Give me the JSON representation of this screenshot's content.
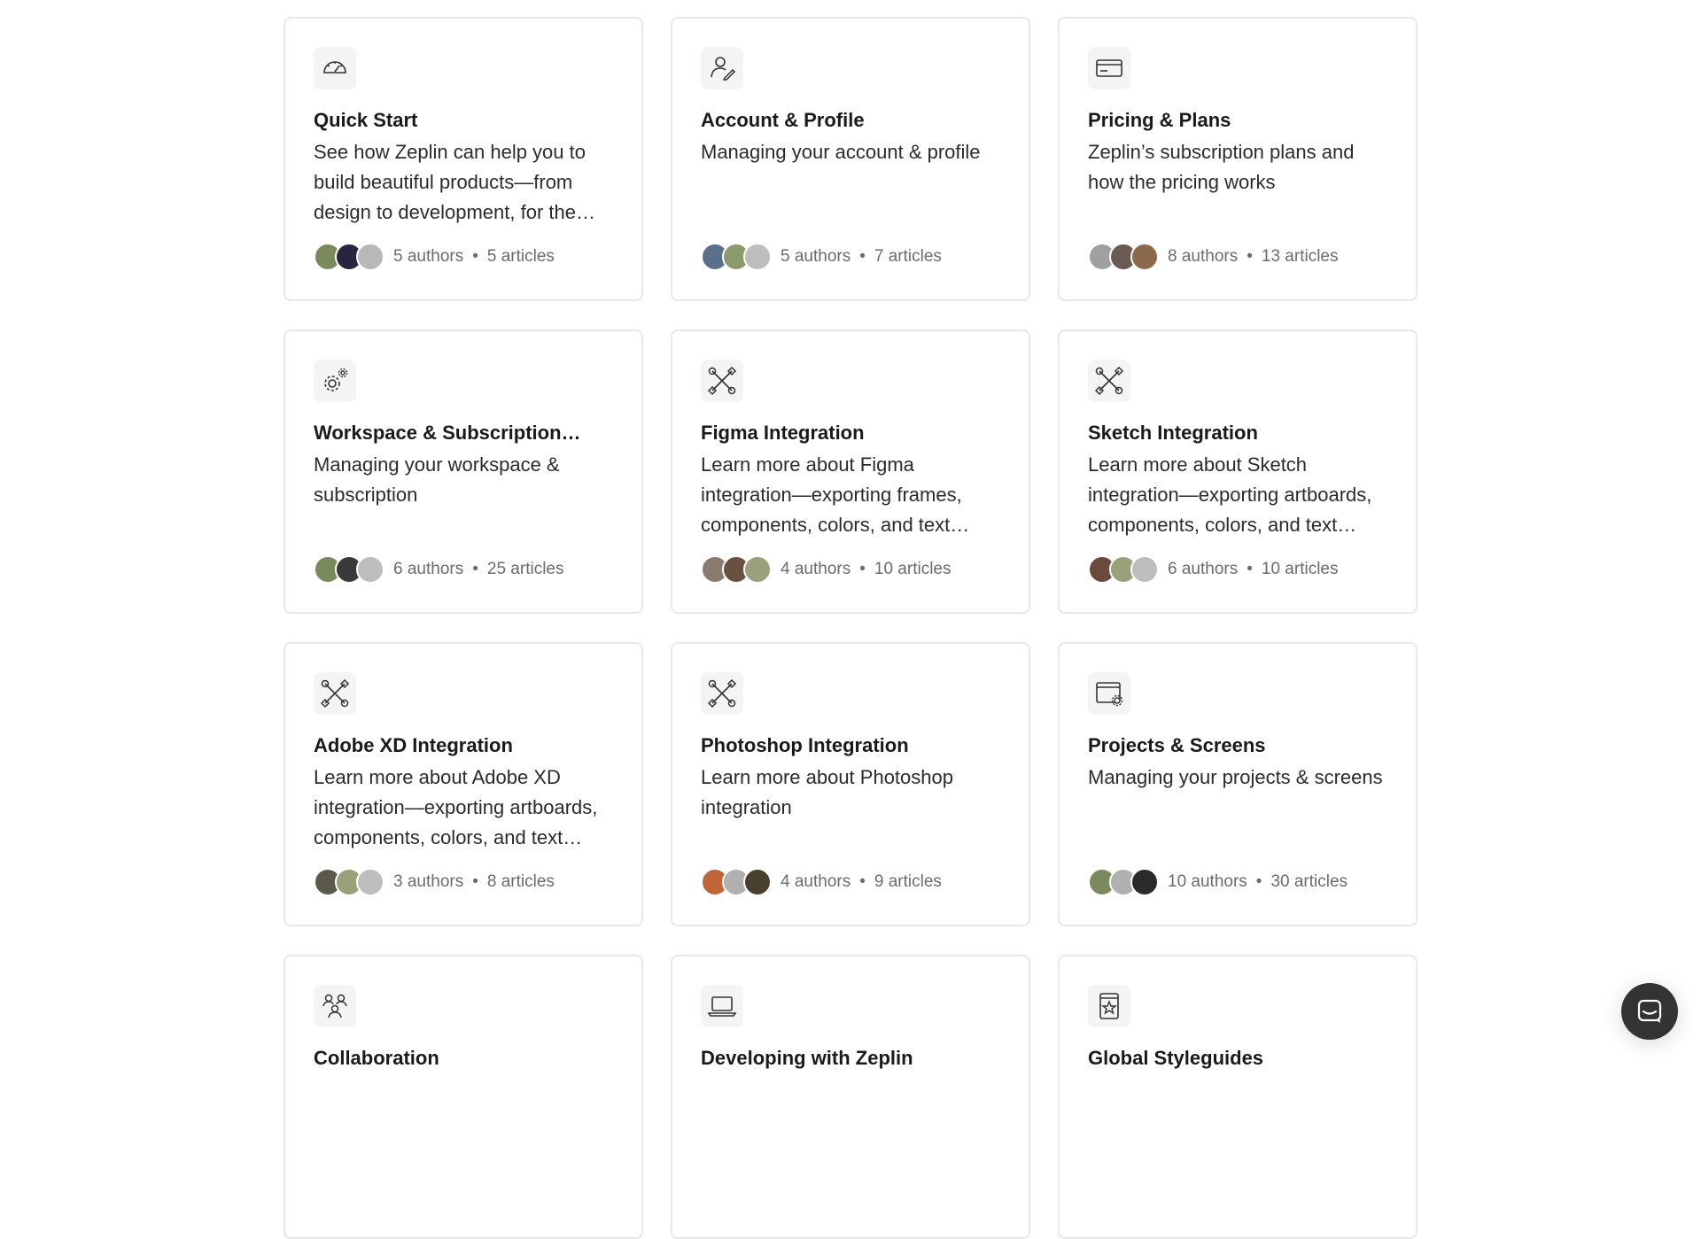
{
  "cards": [
    {
      "icon": "speedometer-icon",
      "title": "Quick Start",
      "desc": "See how Zeplin can help you to build beautiful products—from design to development, for the…",
      "authors": "5 authors",
      "articles": "5 articles",
      "avatar_colors": [
        "#7a8a5c",
        "#2a2440",
        "#b8b8b8"
      ]
    },
    {
      "icon": "user-edit-icon",
      "title": "Account & Profile",
      "desc": "Managing your account & profile",
      "authors": "5 authors",
      "articles": "7 articles",
      "avatar_colors": [
        "#5a6f8a",
        "#8a9a6c",
        "#bdbdbd"
      ]
    },
    {
      "icon": "credit-card-icon",
      "title": "Pricing & Plans",
      "desc": "Zeplin’s subscription plans and how the pricing works",
      "authors": "8 authors",
      "articles": "13 articles",
      "avatar_colors": [
        "#a0a0a0",
        "#6b5a52",
        "#8a6a4a"
      ]
    },
    {
      "icon": "settings-gears-icon",
      "title": "Workspace & Subscription…",
      "desc": "Managing your workspace & subscription",
      "authors": "6 authors",
      "articles": "25 articles",
      "avatar_colors": [
        "#7a8a5c",
        "#3a3a3a",
        "#bdbdbd"
      ]
    },
    {
      "icon": "tools-icon",
      "title": "Figma Integration",
      "desc": "Learn more about Figma integration—exporting frames, components, colors, and text…",
      "authors": "4 authors",
      "articles": "10 articles",
      "avatar_colors": [
        "#8a7a70",
        "#6a5040",
        "#9aa07a"
      ]
    },
    {
      "icon": "tools-icon",
      "title": "Sketch Integration",
      "desc": "Learn more about Sketch integration—exporting artboards, components, colors, and text…",
      "authors": "6 authors",
      "articles": "10 articles",
      "avatar_colors": [
        "#6a4a3a",
        "#9aa07a",
        "#bdbdbd"
      ]
    },
    {
      "icon": "tools-icon",
      "title": "Adobe XD Integration",
      "desc": "Learn more about Adobe XD integration—exporting artboards, components, colors, and text…",
      "authors": "3 authors",
      "articles": "8 articles",
      "avatar_colors": [
        "#5a5a4a",
        "#9aa07a",
        "#bdbdbd"
      ]
    },
    {
      "icon": "tools-icon",
      "title": "Photoshop Integration",
      "desc": "Learn more about Photoshop integration",
      "authors": "4 authors",
      "articles": "9 articles",
      "avatar_colors": [
        "#c0643a",
        "#b0b0b0",
        "#4a4030"
      ]
    },
    {
      "icon": "browser-settings-icon",
      "title": "Projects & Screens",
      "desc": "Managing your projects & screens",
      "authors": "10 authors",
      "articles": "30 articles",
      "avatar_colors": [
        "#7a8a5c",
        "#b0b0b0",
        "#2a2a2a"
      ]
    },
    {
      "icon": "team-icon",
      "title": "Collaboration",
      "desc": "",
      "authors": "",
      "articles": "",
      "avatar_colors": []
    },
    {
      "icon": "laptop-icon",
      "title": "Developing with Zeplin",
      "desc": "",
      "authors": "",
      "articles": "",
      "avatar_colors": []
    },
    {
      "icon": "book-star-icon",
      "title": "Global Styleguides",
      "desc": "",
      "authors": "",
      "articles": "",
      "avatar_colors": []
    }
  ],
  "chat_launcher": {
    "icon": "chat-bubble-icon"
  }
}
